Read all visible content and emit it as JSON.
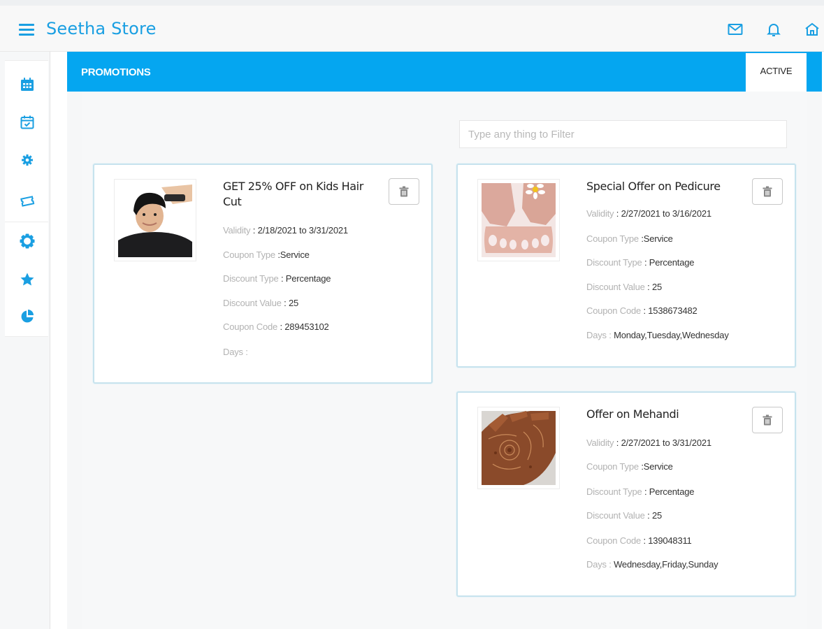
{
  "app": {
    "title": "Seetha Store"
  },
  "topbar": {
    "icons": [
      "mail-icon",
      "bell-icon",
      "home-icon"
    ]
  },
  "sidebar": {
    "items": [
      {
        "name": "calendar-icon"
      },
      {
        "name": "calendar-check-icon"
      },
      {
        "name": "gear-icon"
      },
      {
        "name": "ticket-icon"
      },
      {
        "name": "badge-icon"
      },
      {
        "name": "star-icon"
      },
      {
        "name": "pie-chart-icon"
      }
    ]
  },
  "header": {
    "title": "PROMOTIONS",
    "active_label": "ACTIVE"
  },
  "filter": {
    "placeholder": "Type any thing to Filter"
  },
  "labels": {
    "validity": "Validity",
    "coupon_type": "Coupon Type",
    "discount_type": "Discount Type",
    "discount_value": "Discount Value",
    "coupon_code": "Coupon Code",
    "days": "Days"
  },
  "promotions": [
    {
      "title": "GET 25% OFF on Kids Hair Cut",
      "validity": "2/18/2021 to 3/31/2021",
      "coupon_type": "Service",
      "discount_type": "Percentage",
      "discount_value": "25",
      "coupon_code": "289453102",
      "days": "",
      "image": "kids-haircut-photo"
    },
    {
      "title": "Special Offer on Pedicure",
      "validity": "2/27/2021 to 3/16/2021",
      "coupon_type": "Service",
      "discount_type": "Percentage",
      "discount_value": "25",
      "coupon_code": "1538673482",
      "days": "Monday,Tuesday,Wednesday",
      "image": "pedicure-photo"
    },
    {
      "title": "Offer on Mehandi",
      "validity": "2/27/2021 to 3/31/2021",
      "coupon_type": "Service",
      "discount_type": "Percentage",
      "discount_value": "25",
      "coupon_code": "139048311",
      "days": "Wednesday,Friday,Sunday",
      "image": "mehandi-photo"
    }
  ],
  "colors": {
    "brand": "#1a9fe2",
    "header_bar": "#05a6f0",
    "card_border": "#c7e3ee"
  }
}
